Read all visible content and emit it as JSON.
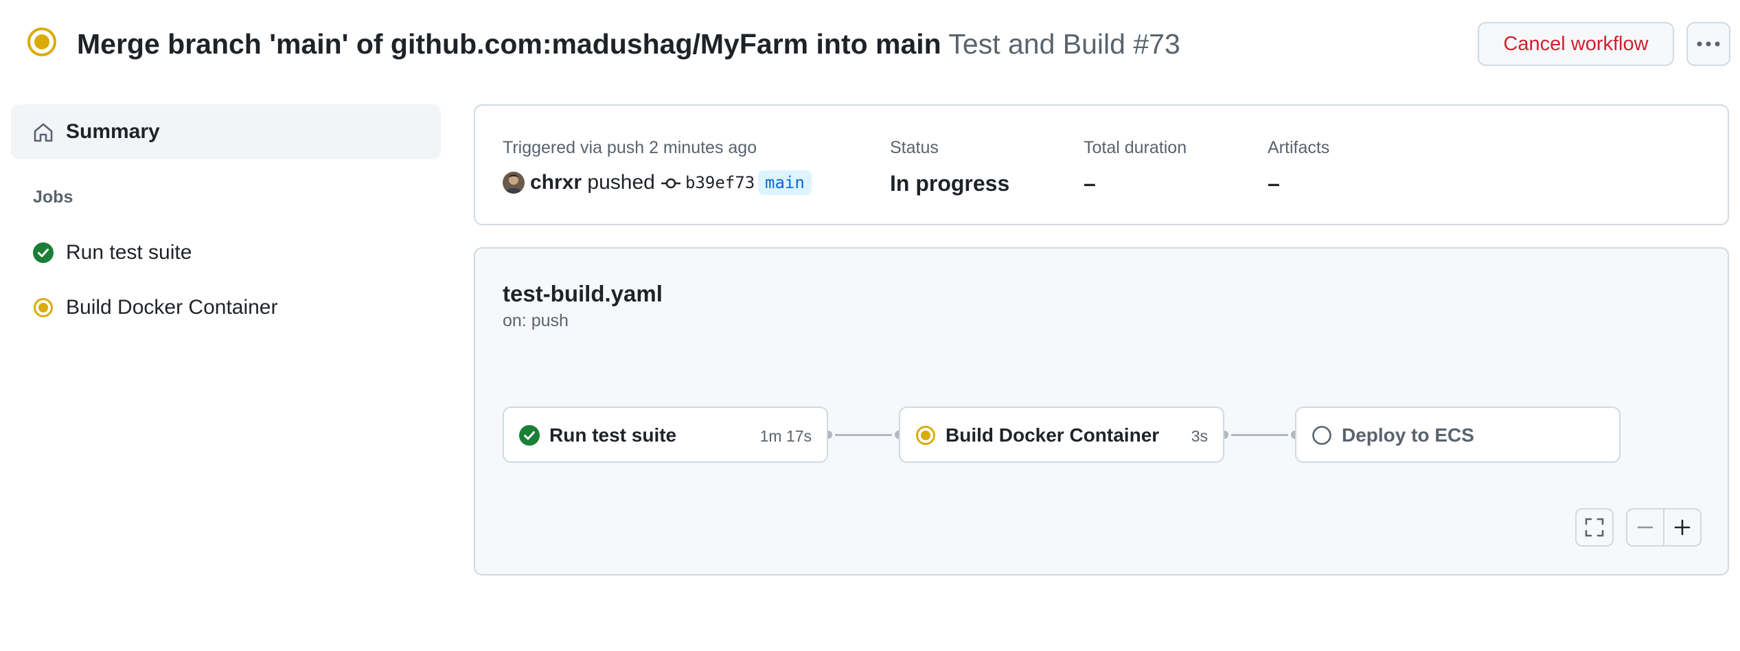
{
  "header": {
    "commit_title": "Merge branch 'main' of github.com:madushag/MyFarm into main",
    "workflow_run": "Test and Build #73",
    "cancel_label": "Cancel workflow",
    "status_icon": "in-progress-icon",
    "more_icon": "kebab-horizontal-icon"
  },
  "sidebar": {
    "summary_label": "Summary",
    "summary_icon": "home-icon",
    "jobs_heading": "Jobs",
    "jobs": [
      {
        "label": "Run test suite",
        "status": "success",
        "icon": "check-circle-icon"
      },
      {
        "label": "Build Docker Container",
        "status": "in_progress",
        "icon": "in-progress-icon"
      }
    ]
  },
  "summary": {
    "trigger_text": "Triggered via push 2 minutes ago",
    "user": "chrxr",
    "action": "pushed",
    "commit_sha": "b39ef73",
    "branch": "main",
    "status_label": "Status",
    "status_value": "In progress",
    "duration_label": "Total duration",
    "duration_value": "–",
    "artifacts_label": "Artifacts",
    "artifacts_value": "–"
  },
  "graph": {
    "workflow_file": "test-build.yaml",
    "trigger": "on: push",
    "nodes": [
      {
        "label": "Run test suite",
        "duration": "1m 17s",
        "status": "success"
      },
      {
        "label": "Build Docker Container",
        "duration": "3s",
        "status": "in_progress"
      },
      {
        "label": "Deploy to ECS",
        "duration": "",
        "status": "queued"
      }
    ],
    "controls": [
      "fullscreen-icon",
      "zoom-out-icon",
      "zoom-in-icon"
    ]
  },
  "colors": {
    "success": "#1a7f37",
    "in_progress": "#bf8700",
    "danger": "#cf222e",
    "link": "#0969da",
    "border": "#d1d9e0",
    "muted": "#59636e"
  }
}
